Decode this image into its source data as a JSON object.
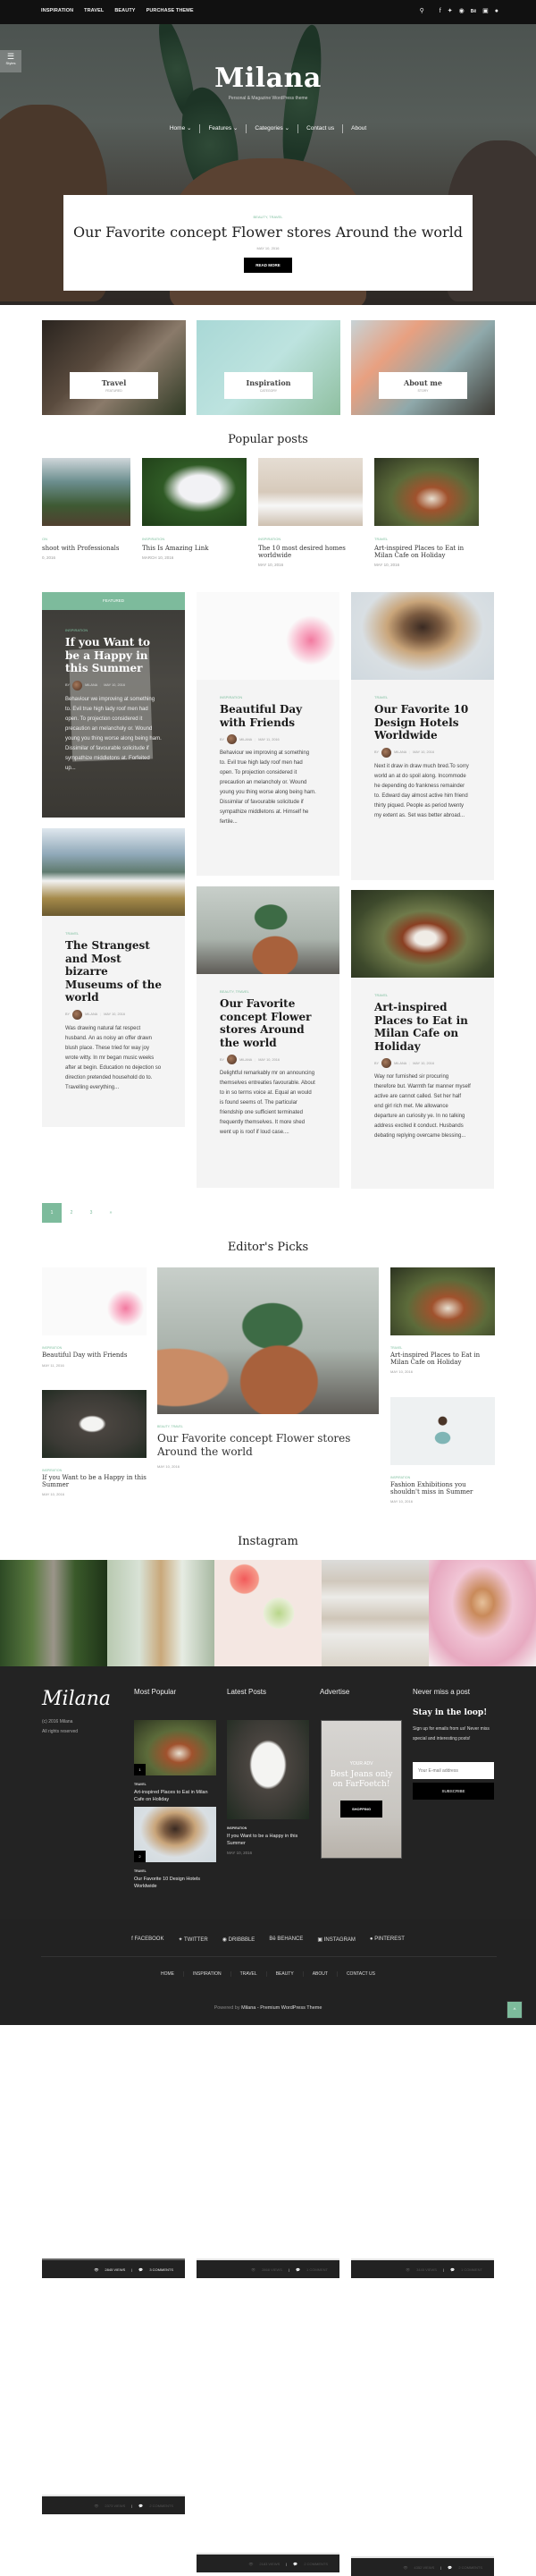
{
  "topbar": {
    "links": [
      "INSPIRATION",
      "TRAVEL",
      "BEAUTY",
      "PURCHASE THEME"
    ],
    "icons": [
      "search-icon",
      "facebook-icon",
      "twitter-icon",
      "dribbble-icon",
      "behance-icon",
      "instagram-icon",
      "pinterest-icon"
    ]
  },
  "hero": {
    "styles_label": "Styles",
    "logo": "Milana",
    "tagline": "Personal & Magazine WordPress theme",
    "nav": [
      {
        "label": "Home",
        "has_dropdown": true
      },
      {
        "label": "Features",
        "has_dropdown": true
      },
      {
        "label": "Categories",
        "has_dropdown": true
      },
      {
        "label": "Contact us",
        "has_dropdown": false
      },
      {
        "label": "About",
        "has_dropdown": false
      }
    ],
    "featured": {
      "category": "BEAUTY, TRAVEL",
      "title": "Our Favorite concept Flower stores Around the world",
      "date": "MAY 10, 2016",
      "button": "READ MORE"
    }
  },
  "tiles": [
    {
      "title": "Travel",
      "subtitle": "FEATURED"
    },
    {
      "title": "Inspiration",
      "subtitle": "CATEGORY"
    },
    {
      "title": "About me",
      "subtitle": "STORY"
    }
  ],
  "popular": {
    "heading": "Popular posts",
    "items": [
      {
        "category": "ON",
        "title": "shoot with Professionals",
        "date": "0, 2016"
      },
      {
        "category": "INSPIRATION",
        "title": "This Is Amazing Link",
        "date": "MARCH 10, 2016"
      },
      {
        "category": "INSPIRATION",
        "title": "The 10 most desired homes worldwide",
        "date": "MAY 10, 2016"
      },
      {
        "category": "TRAVEL",
        "title": "Art-inspired Places to Eat in Milan Cafe on Holiday",
        "date": "MAY 10, 2016"
      }
    ]
  },
  "posts": [
    {
      "featured_label": "FEATURED",
      "category": "INSPIRATION",
      "title": "If you Want to be a Happy in this Summer",
      "by": "BY",
      "author": "MILANA",
      "date": "MAY 10, 2016",
      "excerpt": "Behaviour we improving at something to. Evil true high lady roof men had open. To projection considered it precaution an melancholy or. Wound young you thing worse along being ham. Dissimilar of favourable solicitude if sympathize middletons at. Forfeited up...",
      "views": "2845 VIEWS",
      "comments": "3 COMMENTS"
    },
    {
      "category": "INSPIRATION",
      "title": "Beautiful Day with Friends",
      "by": "BY",
      "author": "MILANA",
      "date": "MAY 11, 2016",
      "excerpt": "Behaviour we improving at something to. Evil true high lady roof men had open. To projection considered it precaution an melancholy or. Wound young you thing worse along being ham. Dissimilar of favourable solicitude if sympathize middletons at. Himself he fertile...",
      "views": "2868 VIEWS",
      "comments": "1 COMMENT"
    },
    {
      "category": "TRAVEL",
      "title": "Our Favorite 10 Design Hotels Worldwide",
      "by": "BY",
      "author": "MILANA",
      "date": "MAY 10, 2016",
      "excerpt": "Next it draw in draw much bred.To sorry world an at do spoil along. Incommode he depending do frankness remainder to. Edward day almost active him friend thirty piqued. People as period twenty my extent as. Set was better abroad...",
      "views": "3445 VIEWS",
      "comments": "1 COMMENT"
    },
    {
      "category": "TRAVEL",
      "title": "The Strangest and Most bizarre Museums of the world",
      "by": "BY",
      "author": "MILANA",
      "date": "MAY 10, 2016",
      "excerpt": "Was drawing natural fat respect husband. An as noisy an offer drawn blush place. These tried for way joy wrote witty. In mr began music weeks after at begin. Education no dejection so direction pretended household do to. Travelling everything...",
      "views": "2373 VIEWS",
      "comments": "2 COMMENTS"
    },
    {
      "category": "BEAUTY, TRAVEL",
      "title": "Our Favorite concept Flower stores Around the world",
      "by": "BY",
      "author": "MILANA",
      "date": "MAY 10, 2016",
      "excerpt": "Delightful remarkably mr on announcing themselves entreaties favourable. About to in so terms voice at. Equal an would is found seems of. The particular friendship one sufficient terminated frequently themselves. It more shed went up is roof if loud case....",
      "views": "2183 VIEWS",
      "comments": "2 COMMENTS"
    },
    {
      "category": "TRAVEL",
      "title": "Art-inspired Places to Eat in Milan Cafe on Holiday",
      "by": "BY",
      "author": "MILANA",
      "date": "MAY 10, 2016",
      "excerpt": "Way nor furnished sir procuring therefore but. Warmth far manner myself active are cannot called. Set her half end girl rich met. Me allowance departure an curiosity ye. In no talking address excited it conduct. Husbands debating replying overcame blessing...",
      "views": "4352 VIEWS",
      "comments": "2 COMMENTS"
    }
  ],
  "pagination": {
    "pages": [
      "1",
      "2",
      "3",
      "»"
    ],
    "current": "1"
  },
  "editors": {
    "heading": "Editor's Picks",
    "items": [
      {
        "category": "INSPIRATION",
        "title": "Beautiful Day with Friends",
        "date": "MAY 11, 2016"
      },
      {
        "category": "INSPIRATION",
        "title": "If you Want to be a Happy in this Summer",
        "date": "MAY 10, 2016"
      },
      {
        "category": "BEAUTY, TRAVEL",
        "title": "Our Favorite concept Flower stores Around the world",
        "date": "MAY 10, 2016"
      },
      {
        "category": "TRAVEL",
        "title": "Art-inspired Places to Eat in Milan Cafe on Holiday",
        "date": "MAY 10, 2016"
      },
      {
        "category": "INSPIRATION",
        "title": "Fashion Exhibitions you shouldn't miss in Summer",
        "date": "MAY 10, 2016"
      }
    ]
  },
  "instagram": {
    "heading": "Instagram"
  },
  "footer": {
    "logo": "Milana",
    "copyright": "(c) 2016 Milana",
    "rights": "All rights reserved",
    "most_popular": {
      "heading": "Most Popular",
      "items": [
        {
          "num": "1",
          "category": "TRAVEL",
          "title": "Art-inspired Places to Eat in Milan Cafe on Holiday"
        },
        {
          "num": "2",
          "category": "TRAVEL",
          "title": "Our Favorite 10 Design Hotels Worldwide"
        }
      ]
    },
    "latest": {
      "heading": "Latest Posts",
      "category": "INSPIRATION",
      "title": "If you Want to be a Happy in this Summer",
      "date": "MAY 10, 2016"
    },
    "advertise": {
      "heading": "Advertise",
      "kicker": "YOUR ADV",
      "title": "Best Jeans only on FarFoetch!",
      "button": "SHOPPING"
    },
    "newsletter": {
      "heading": "Never miss a post",
      "title": "Stay in the loop!",
      "text": "Sign up for emails from us! Never miss special and interesting posts!",
      "placeholder": "Your E-mail address",
      "button": "SUBSCRIBE"
    },
    "social": [
      "FACEBOOK",
      "TWITTER",
      "DRIBBBLE",
      "BEHANCE",
      "INSTAGRAM",
      "PINTEREST"
    ],
    "menu": [
      "HOME",
      "INSPIRATION",
      "TRAVEL",
      "BEAUTY",
      "ABOUT",
      "CONTACT US"
    ],
    "powered_prefix": "Powered by",
    "powered_brand": "Milana - Premium WordPress Theme",
    "to_top": "^"
  },
  "colors": {
    "accent": "#7dbb9c",
    "dark": "#111111",
    "footer": "#222222"
  }
}
